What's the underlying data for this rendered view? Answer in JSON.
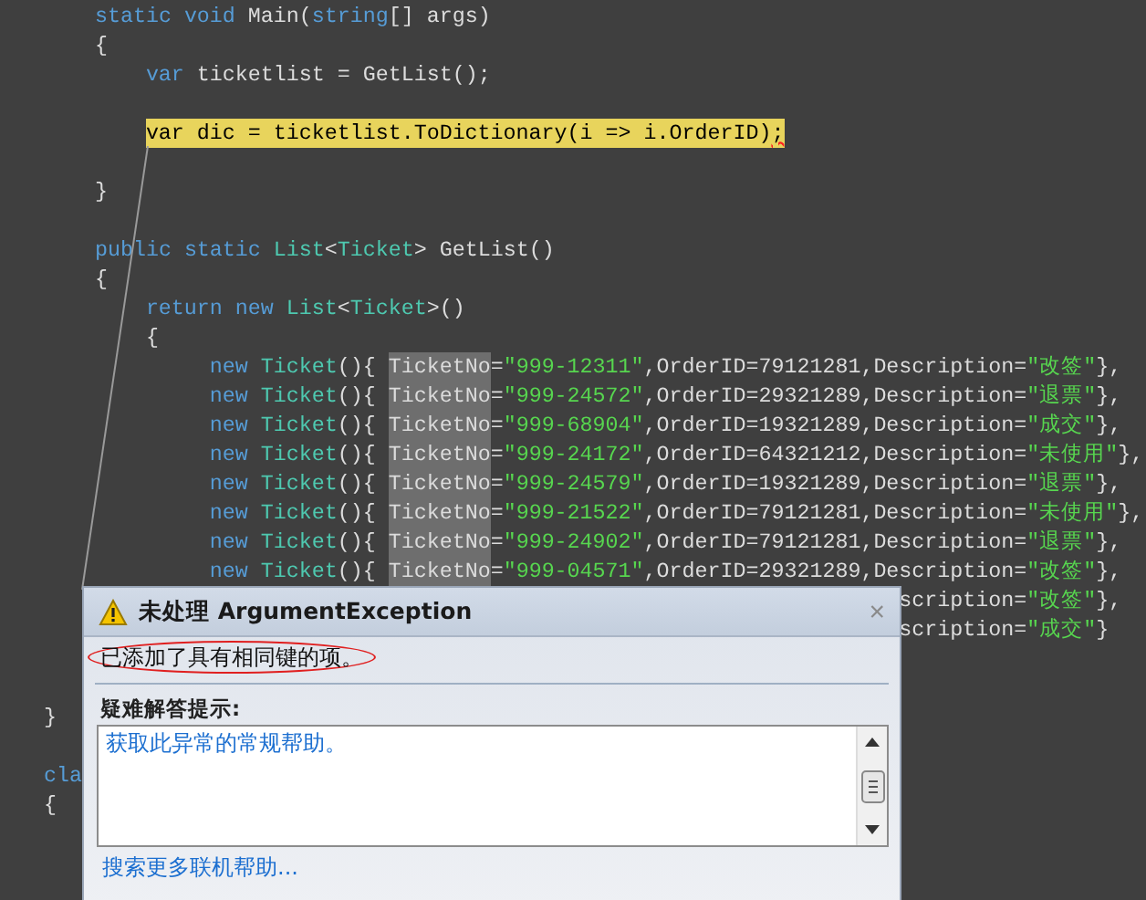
{
  "editor": {
    "lines": [
      {
        "children": [
          {
            "tokens": [
              {
                "kind": "kw",
                "text": "static "
              },
              {
                "kind": "kw",
                "text": "void"
              },
              {
                "kind": "plain",
                "text": " Main("
              },
              {
                "kind": "kw",
                "text": "string"
              },
              {
                "kind": "plain",
                "text": "[] args)"
              }
            ]
          },
          {
            "tokens": [
              {
                "kind": "plain",
                "text": "{"
              }
            ]
          },
          {
            "children": [
              {
                "tokens": [
                  {
                    "kind": "kw",
                    "text": "var"
                  },
                  {
                    "kind": "plain",
                    "text": " ticketlist = GetList();"
                  }
                ]
              },
              {
                "kind": "blank"
              },
              {
                "highlighted": true,
                "tokens": [
                  {
                    "kind": "plain",
                    "text": "var dic = ticketlist.ToDictionary(i => i.OrderID)"
                  },
                  {
                    "kind": "error",
                    "text": ";"
                  }
                ]
              },
              {
                "kind": "blank"
              }
            ]
          },
          {
            "tokens": [
              {
                "kind": "plain",
                "text": "}"
              }
            ]
          },
          {
            "kind": "blank"
          },
          {
            "tokens": [
              {
                "kind": "kw",
                "text": "public "
              },
              {
                "kind": "kw",
                "text": "static "
              },
              {
                "kind": "type",
                "text": "List"
              },
              {
                "kind": "plain",
                "text": "<"
              },
              {
                "kind": "type",
                "text": "Ticket"
              },
              {
                "kind": "plain",
                "text": "> GetList()"
              }
            ]
          },
          {
            "tokens": [
              {
                "kind": "plain",
                "text": "{"
              }
            ]
          },
          {
            "children": [
              {
                "tokens": [
                  {
                    "kind": "kw",
                    "text": "return "
                  },
                  {
                    "kind": "kw",
                    "text": "new "
                  },
                  {
                    "kind": "type",
                    "text": "List"
                  },
                  {
                    "kind": "plain",
                    "text": "<"
                  },
                  {
                    "kind": "type",
                    "text": "Ticket"
                  },
                  {
                    "kind": "plain",
                    "text": ">()"
                  }
                ]
              },
              {
                "tokens": [
                  {
                    "kind": "plain",
                    "text": "{"
                  }
                ]
              },
              {
                "kind": "item",
                "tokens": [
                  {
                    "kind": "kw",
                    "text": "new "
                  },
                  {
                    "kind": "type",
                    "text": "Ticket"
                  },
                  {
                    "kind": "plain",
                    "text": "(){ "
                  },
                  {
                    "kind": "sel",
                    "text": "TicketNo"
                  },
                  {
                    "kind": "plain",
                    "text": "="
                  },
                  {
                    "kind": "str",
                    "text": "\"999-12311\""
                  },
                  {
                    "kind": "plain",
                    "text": ",OrderID=79121281,Description="
                  },
                  {
                    "kind": "str",
                    "text": "\"改签\""
                  },
                  {
                    "kind": "plain",
                    "text": "},"
                  }
                ]
              },
              {
                "kind": "item",
                "tokens": [
                  {
                    "kind": "kw",
                    "text": "new "
                  },
                  {
                    "kind": "type",
                    "text": "Ticket"
                  },
                  {
                    "kind": "plain",
                    "text": "(){ "
                  },
                  {
                    "kind": "sel",
                    "text": "TicketNo"
                  },
                  {
                    "kind": "plain",
                    "text": "="
                  },
                  {
                    "kind": "str",
                    "text": "\"999-24572\""
                  },
                  {
                    "kind": "plain",
                    "text": ",OrderID=29321289,Description="
                  },
                  {
                    "kind": "str",
                    "text": "\"退票\""
                  },
                  {
                    "kind": "plain",
                    "text": "},"
                  }
                ]
              },
              {
                "kind": "item",
                "tokens": [
                  {
                    "kind": "kw",
                    "text": "new "
                  },
                  {
                    "kind": "type",
                    "text": "Ticket"
                  },
                  {
                    "kind": "plain",
                    "text": "(){ "
                  },
                  {
                    "kind": "sel",
                    "text": "TicketNo"
                  },
                  {
                    "kind": "plain",
                    "text": "="
                  },
                  {
                    "kind": "str",
                    "text": "\"999-68904\""
                  },
                  {
                    "kind": "plain",
                    "text": ",OrderID=19321289,Description="
                  },
                  {
                    "kind": "str",
                    "text": "\"成交\""
                  },
                  {
                    "kind": "plain",
                    "text": "},"
                  }
                ]
              },
              {
                "kind": "item",
                "tokens": [
                  {
                    "kind": "kw",
                    "text": "new "
                  },
                  {
                    "kind": "type",
                    "text": "Ticket"
                  },
                  {
                    "kind": "plain",
                    "text": "(){ "
                  },
                  {
                    "kind": "sel",
                    "text": "TicketNo"
                  },
                  {
                    "kind": "plain",
                    "text": "="
                  },
                  {
                    "kind": "str",
                    "text": "\"999-24172\""
                  },
                  {
                    "kind": "plain",
                    "text": ",OrderID=64321212,Description="
                  },
                  {
                    "kind": "str",
                    "text": "\"未使用\""
                  },
                  {
                    "kind": "plain",
                    "text": "},"
                  }
                ]
              },
              {
                "kind": "item",
                "tokens": [
                  {
                    "kind": "kw",
                    "text": "new "
                  },
                  {
                    "kind": "type",
                    "text": "Ticket"
                  },
                  {
                    "kind": "plain",
                    "text": "(){ "
                  },
                  {
                    "kind": "sel",
                    "text": "TicketNo"
                  },
                  {
                    "kind": "plain",
                    "text": "="
                  },
                  {
                    "kind": "str",
                    "text": "\"999-24579\""
                  },
                  {
                    "kind": "plain",
                    "text": ",OrderID=19321289,Description="
                  },
                  {
                    "kind": "str",
                    "text": "\"退票\""
                  },
                  {
                    "kind": "plain",
                    "text": "},"
                  }
                ]
              },
              {
                "kind": "item",
                "tokens": [
                  {
                    "kind": "kw",
                    "text": "new "
                  },
                  {
                    "kind": "type",
                    "text": "Ticket"
                  },
                  {
                    "kind": "plain",
                    "text": "(){ "
                  },
                  {
                    "kind": "sel",
                    "text": "TicketNo"
                  },
                  {
                    "kind": "plain",
                    "text": "="
                  },
                  {
                    "kind": "str",
                    "text": "\"999-21522\""
                  },
                  {
                    "kind": "plain",
                    "text": ",OrderID=79121281,Description="
                  },
                  {
                    "kind": "str",
                    "text": "\"未使用\""
                  },
                  {
                    "kind": "plain",
                    "text": "},"
                  }
                ]
              },
              {
                "kind": "item",
                "tokens": [
                  {
                    "kind": "kw",
                    "text": "new "
                  },
                  {
                    "kind": "type",
                    "text": "Ticket"
                  },
                  {
                    "kind": "plain",
                    "text": "(){ "
                  },
                  {
                    "kind": "sel",
                    "text": "TicketNo"
                  },
                  {
                    "kind": "plain",
                    "text": "="
                  },
                  {
                    "kind": "str",
                    "text": "\"999-24902\""
                  },
                  {
                    "kind": "plain",
                    "text": ",OrderID=79121281,Description="
                  },
                  {
                    "kind": "str",
                    "text": "\"退票\""
                  },
                  {
                    "kind": "plain",
                    "text": "},"
                  }
                ]
              },
              {
                "kind": "item",
                "tokens": [
                  {
                    "kind": "kw",
                    "text": "new "
                  },
                  {
                    "kind": "type",
                    "text": "Ticket"
                  },
                  {
                    "kind": "plain",
                    "text": "(){ "
                  },
                  {
                    "kind": "sel",
                    "text": "TicketNo"
                  },
                  {
                    "kind": "plain",
                    "text": "="
                  },
                  {
                    "kind": "str",
                    "text": "\"999-04571\""
                  },
                  {
                    "kind": "plain",
                    "text": ",OrderID=29321289,Description="
                  },
                  {
                    "kind": "str",
                    "text": "\"改签\""
                  },
                  {
                    "kind": "plain",
                    "text": "},"
                  }
                ]
              },
              {
                "kind": "partial",
                "tokens": [
                  {
                    "kind": "plain",
                    "text": "scription="
                  },
                  {
                    "kind": "str",
                    "text": "\"改签\""
                  },
                  {
                    "kind": "plain",
                    "text": "},"
                  }
                ]
              },
              {
                "kind": "partial",
                "tokens": [
                  {
                    "kind": "plain",
                    "text": "scription="
                  },
                  {
                    "kind": "str",
                    "text": "\"成交\""
                  },
                  {
                    "kind": "plain",
                    "text": "}"
                  }
                ]
              }
            ]
          }
        ]
      },
      {
        "kind": "blank"
      },
      {
        "kind": "blank"
      },
      {
        "tokens": [
          {
            "kind": "plain",
            "text": "}"
          }
        ]
      },
      {
        "kind": "blank"
      },
      {
        "tokens": [
          {
            "kind": "kw",
            "text": "cla"
          }
        ]
      },
      {
        "tokens": [
          {
            "kind": "plain",
            "text": "{"
          }
        ]
      }
    ]
  },
  "exception_helper": {
    "title_prefix": "未处理",
    "title": "ArgumentException",
    "close_glyph": "×",
    "message": "已添加了具有相同键的项。",
    "tips_heading": "疑难解答提示:",
    "tips": [
      "获取此异常的常规帮助。"
    ],
    "more_help_link": "搜索更多联机帮助..."
  }
}
